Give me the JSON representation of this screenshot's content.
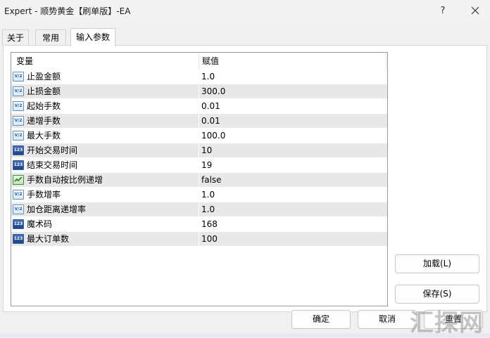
{
  "window": {
    "title": "Expert - 顺势黄金【刷单版】-EA",
    "help_label": "?"
  },
  "tabs": [
    {
      "label": "关于",
      "active": false
    },
    {
      "label": "常用",
      "active": false
    },
    {
      "label": "输入参数",
      "active": true
    }
  ],
  "grid": {
    "columns": [
      "变量",
      "赋值"
    ],
    "rows": [
      {
        "name": "止盈金额",
        "value": "1.0",
        "type": "double",
        "icon_text": "V/2"
      },
      {
        "name": "止损金额",
        "value": "300.0",
        "type": "double",
        "icon_text": "V/2"
      },
      {
        "name": "起始手数",
        "value": "0.01",
        "type": "double",
        "icon_text": "V/2"
      },
      {
        "name": "递增手数",
        "value": "0.01",
        "type": "double",
        "icon_text": "V/2"
      },
      {
        "name": "最大手数",
        "value": "100.0",
        "type": "double",
        "icon_text": "V/2"
      },
      {
        "name": "开始交易时间",
        "value": "10",
        "type": "int",
        "icon_text": "123"
      },
      {
        "name": "结束交易时间",
        "value": "19",
        "type": "int",
        "icon_text": "123"
      },
      {
        "name": "手数自动按比例递增",
        "value": "false",
        "type": "bool",
        "icon_text": ""
      },
      {
        "name": "手数增率",
        "value": "1.0",
        "type": "double",
        "icon_text": "V/2"
      },
      {
        "name": "加仓距离递增率",
        "value": "1.0",
        "type": "double",
        "icon_text": "V/2"
      },
      {
        "name": "魔术码",
        "value": "168",
        "type": "int",
        "icon_text": "123"
      },
      {
        "name": "最大订单数",
        "value": "100",
        "type": "int",
        "icon_text": "123"
      }
    ]
  },
  "buttons": {
    "load": "加载(L)",
    "save": "保存(S)",
    "ok": "确定",
    "cancel": "取消",
    "reset": "重置"
  },
  "watermark": "汇探网"
}
